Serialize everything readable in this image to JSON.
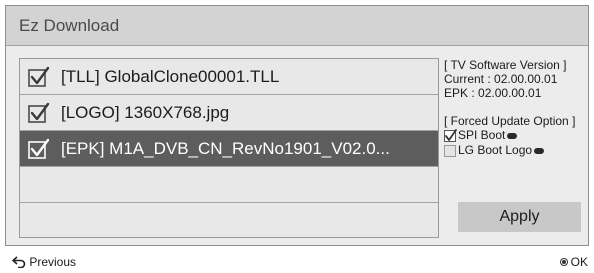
{
  "window": {
    "title": "Ez Download"
  },
  "files": [
    {
      "name": "[TLL] GlobalClone00001.TLL",
      "checked": true
    },
    {
      "name": "[LOGO] 1360X768.jpg",
      "checked": true
    },
    {
      "name": "[EPK] M1A_DVB_CN_RevNo1901_V02.0...",
      "checked": true,
      "selected": true
    },
    {
      "name": "",
      "checked": false
    },
    {
      "name": "",
      "checked": false
    }
  ],
  "info": {
    "version_header": "[ TV Software Version ]",
    "current": "Current : 02.00.00.01",
    "epk": "EPK : 02.00.00.01",
    "forced_header": "[ Forced Update Option ]",
    "options": [
      {
        "label": "SPI Boot",
        "checked": true
      },
      {
        "label": "LG Boot Logo",
        "checked": false
      }
    ]
  },
  "apply_label": "Apply",
  "footer": {
    "previous_label": "Previous",
    "ok_label": "OK"
  },
  "colors": {
    "selected_row": "#5d5d5d",
    "titlebar": "#d3d3d3",
    "apply_button": "#c8c8c8"
  }
}
